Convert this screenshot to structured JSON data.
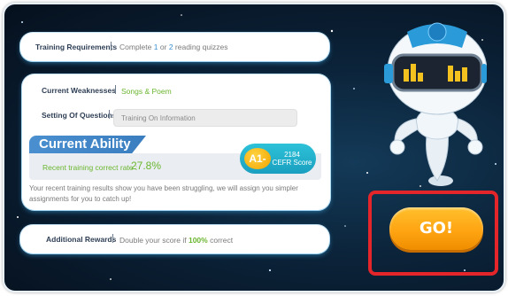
{
  "training_requirements": {
    "label": "Training Requirements",
    "prefix": "Complete",
    "num1": "1",
    "or": "or",
    "num2": "2",
    "suffix": "reading quizzes"
  },
  "weaknesses": {
    "label": "Current Weaknesses",
    "value": "Songs & Poem"
  },
  "setting": {
    "label": "Setting Of Questions",
    "value": "Training On Information"
  },
  "ability": {
    "title": "Current Ability",
    "rate_label": "Recent training correct rate :",
    "rate_value": "27.8%",
    "level": "A1-",
    "score": "2184",
    "score_label": "CEFR Score",
    "feedback": "Your recent training results show you have been struggling, we will assign you simpler assignments for you to catch up!"
  },
  "rewards": {
    "label": "Additional Rewards",
    "prefix": "Double your score if",
    "percent": "100%",
    "suffix": "correct"
  },
  "go_button": {
    "label": "GO!"
  },
  "colors": {
    "accent_blue": "#3a8fd0",
    "accent_green": "#6ab52e",
    "go_orange": "#ffa412",
    "highlight_red": "#e4262b",
    "badge_teal": "#1a9fc0"
  }
}
